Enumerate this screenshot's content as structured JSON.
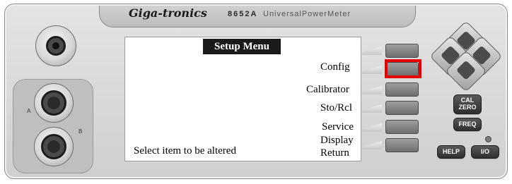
{
  "header": {
    "brand": "Giga-tronics",
    "model": "8652A",
    "subtitle": "UniversalPowerMeter"
  },
  "screen": {
    "title": "Setup Menu",
    "menu_items": [
      "Config",
      "Calibrator",
      "Sto/Rcl",
      "Service",
      "Display",
      "Return"
    ],
    "status": "Select item to be altered"
  },
  "sensor_inputs": {
    "a_label": "A",
    "b_label": "B"
  },
  "keys": {
    "cal_zero_line1": "CAL",
    "cal_zero_line2": "ZERO",
    "freq": "FREQ",
    "help": "HELP",
    "io": "I/O"
  },
  "highlight": {
    "color": "#e60000",
    "target": "Config"
  },
  "icons": [
    "rf-connector-icon",
    "sensor-connector-icon",
    "arrow-up-icon",
    "arrow-left-icon",
    "arrow-right-icon",
    "arrow-down-icon",
    "power-led-icon"
  ]
}
